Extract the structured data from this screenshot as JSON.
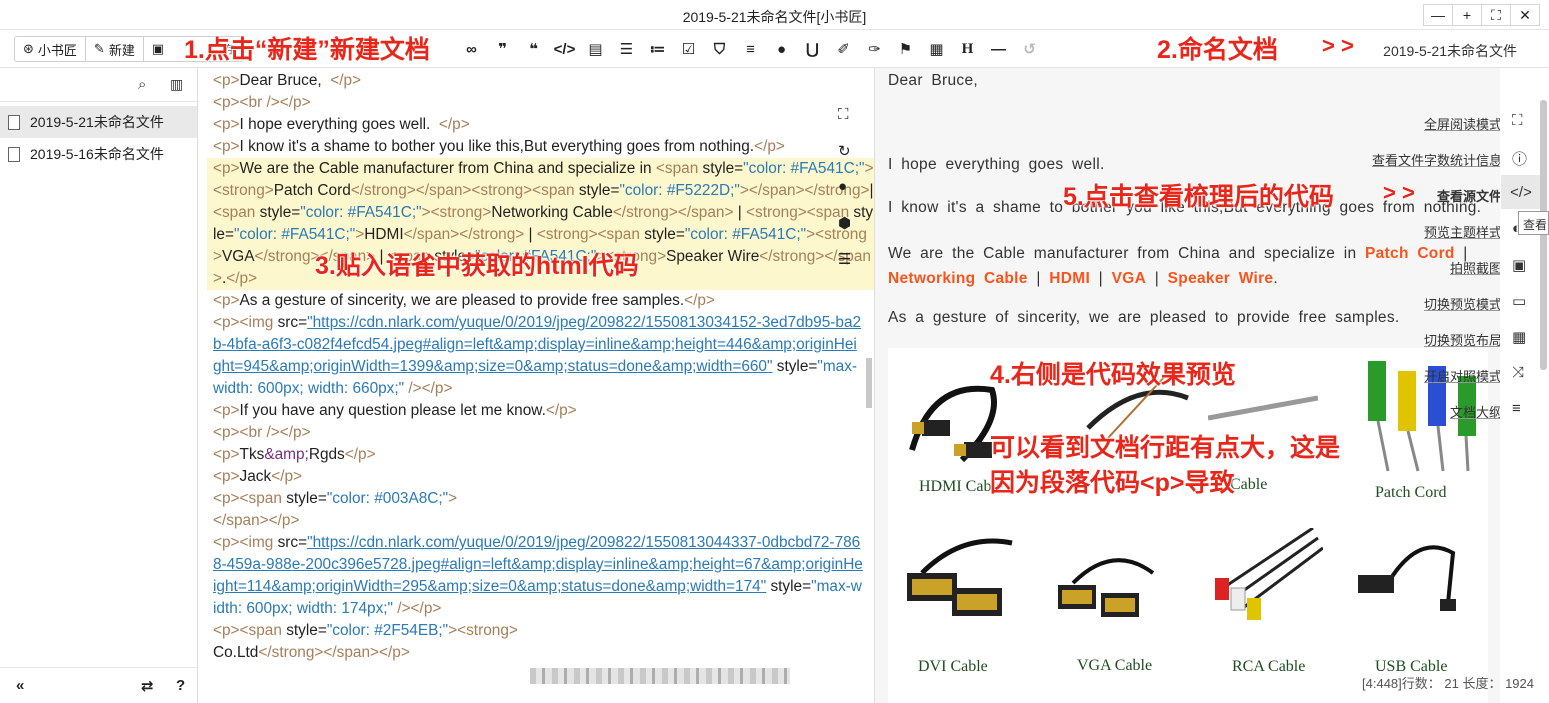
{
  "window": {
    "title": "2019-5-21未命名文件[小书匠]",
    "controls": [
      "—",
      "+",
      "⛶",
      "✕"
    ]
  },
  "toolbar": {
    "app_label": "小书匠",
    "new_label": "新建",
    "save_label": "存",
    "doc_name": "2019-5-21未命名文件",
    "icons": [
      "link-icon",
      "quote-open-icon",
      "quote-close-icon",
      "code-icon",
      "file-icon",
      "ordered-list-icon",
      "unordered-list-icon",
      "task-list-icon",
      "html5-icon",
      "align-icon",
      "clock-icon",
      "magnet-icon",
      "edit-note-icon",
      "edit-note-alt-icon",
      "flag-icon",
      "table-icon",
      "heading-icon",
      "hr-icon",
      "undo-icon"
    ]
  },
  "sidebar": {
    "files": [
      {
        "name": "2019-5-21未命名文件",
        "active": true
      },
      {
        "name": "2019-5-16未命名文件",
        "active": false
      }
    ],
    "bottom": {
      "collapse": "«",
      "swap": "⇄",
      "help": "?"
    }
  },
  "editor": {
    "lines": [
      {
        "parts": [
          [
            "t",
            "<p>"
          ],
          [
            "x",
            "Dear Bruce,  "
          ],
          [
            "t",
            "</p>"
          ]
        ]
      },
      {
        "parts": [
          [
            "t",
            "<p><br /></p>"
          ]
        ]
      },
      {
        "parts": [
          [
            "t",
            "<p>"
          ],
          [
            "x",
            "I hope everything goes well.  "
          ],
          [
            "t",
            "</p>"
          ]
        ]
      },
      {
        "parts": [
          [
            "t",
            "<p>"
          ],
          [
            "x",
            "I know it's a shame to bother you like this,But everything goes from nothing."
          ],
          [
            "t",
            "</p>"
          ]
        ]
      },
      {
        "hl": true,
        "parts": [
          [
            "t",
            "<p>"
          ],
          [
            "x",
            "We are the Cable manufacturer from China and specialize in "
          ],
          [
            "t",
            "<span "
          ],
          [
            "x",
            "style="
          ],
          [
            "s",
            "\"color: #FA541C;\""
          ],
          [
            "t",
            "><strong>"
          ],
          [
            "x",
            "Patch Cord"
          ],
          [
            "t",
            "</strong></span><strong><span "
          ],
          [
            "x",
            "style="
          ],
          [
            "s",
            "\"color: #F5222D;\""
          ],
          [
            "t",
            "></span></strong>"
          ],
          [
            "x",
            "| "
          ],
          [
            "t",
            "<span "
          ],
          [
            "x",
            "style="
          ],
          [
            "s",
            "\"color: #FA541C;\""
          ],
          [
            "t",
            "><strong>"
          ],
          [
            "x",
            "Networking Cable"
          ],
          [
            "t",
            "</strong></span>"
          ],
          [
            "x",
            " | "
          ],
          [
            "t",
            "<strong><span "
          ],
          [
            "x",
            "style="
          ],
          [
            "s",
            "\"color: #FA541C;\""
          ],
          [
            "t",
            ">"
          ],
          [
            "x",
            "HDMI"
          ],
          [
            "t",
            "</span></strong>"
          ],
          [
            "x",
            " | "
          ],
          [
            "t",
            "<strong><span "
          ],
          [
            "x",
            "style="
          ],
          [
            "s",
            "\"color: #FA541C;\""
          ],
          [
            "t",
            "><strong>"
          ],
          [
            "x",
            "VGA"
          ],
          [
            "t",
            "</strong></span>"
          ],
          [
            "x",
            " | "
          ],
          [
            "t",
            "<span "
          ],
          [
            "x",
            "style="
          ],
          [
            "s",
            "\"color: #FA541C;\""
          ],
          [
            "t",
            "><strong>"
          ],
          [
            "x",
            "Speaker Wire"
          ],
          [
            "t",
            "</strong></span>"
          ],
          [
            "x",
            "."
          ],
          [
            "t",
            "</p>"
          ]
        ]
      },
      {
        "parts": [
          [
            "t",
            "<p>"
          ],
          [
            "x",
            "As a gesture of sincerity, we are pleased to provide free samples."
          ],
          [
            "t",
            "</p>"
          ]
        ]
      },
      {
        "parts": [
          [
            "t",
            "<p><img "
          ],
          [
            "x",
            "src="
          ],
          [
            "l",
            "\"https://cdn.nlark.com/yuque/0/2019/jpeg/209822/1550813034152-3ed7db95-ba2b-4bfa-a6f3-c082f4efcd54.jpeg#align=left&amp;display=inline&amp;height=446&amp;originHeight=945&amp;originWidth=1399&amp;size=0&amp;status=done&amp;width=660\""
          ],
          [
            "x",
            " style="
          ],
          [
            "s",
            "\"max-width: 600px; width: 660px;\""
          ],
          [
            "t",
            " /></p>"
          ]
        ]
      },
      {
        "parts": [
          [
            "t",
            "<p>"
          ],
          [
            "x",
            "If you have any question please let me know."
          ],
          [
            "t",
            "</p>"
          ]
        ]
      },
      {
        "parts": [
          [
            "t",
            "<p><br /></p>"
          ]
        ]
      },
      {
        "parts": [
          [
            "t",
            "<p>"
          ],
          [
            "x",
            "Tks"
          ],
          [
            "e",
            "&amp;"
          ],
          [
            "x",
            "Rgds"
          ],
          [
            "t",
            "</p>"
          ]
        ]
      },
      {
        "parts": [
          [
            "t",
            "<p>"
          ],
          [
            "x",
            "Jack"
          ],
          [
            "t",
            "</p>"
          ]
        ]
      },
      {
        "parts": [
          [
            "t",
            "<p><span "
          ],
          [
            "x",
            "style="
          ],
          [
            "s",
            "\"color: #003A8C;\""
          ],
          [
            "t",
            ">"
          ]
        ]
      },
      {
        "parts": [
          [
            "t",
            "</span></p>"
          ]
        ]
      },
      {
        "parts": [
          [
            "t",
            "<p><img "
          ],
          [
            "x",
            "src="
          ],
          [
            "l",
            "\"https://cdn.nlark.com/yuque/0/2019/jpeg/209822/1550813044337-0dbcbd72-7868-459a-988e-200c396e5728.jpeg#align=left&amp;display=inline&amp;height=67&amp;originHeight=114&amp;originWidth=295&amp;size=0&amp;status=done&amp;width=174\""
          ],
          [
            "x",
            " style="
          ],
          [
            "s",
            "\"max-width: 600px; width: 174px;\""
          ],
          [
            "t",
            " /></p>"
          ]
        ]
      },
      {
        "parts": [
          [
            "t",
            "<p><span "
          ],
          [
            "x",
            "style="
          ],
          [
            "s",
            "\"color: #2F54EB;\""
          ],
          [
            "t",
            "><strong>"
          ]
        ]
      },
      {
        "parts": [
          [
            "x",
            "Co.Ltd"
          ],
          [
            "t",
            "</strong></span></p>"
          ]
        ]
      }
    ]
  },
  "preview": {
    "greeting": "Dear  Bruce,",
    "p1": "I  hope  everything  goes  well.",
    "p2": "I  know  it's  a  shame  to  bother  you  like  this,But  everything  goes  from  nothing.",
    "p3_pre": "We  are  the  Cable  manufacturer  from  China  and  specialize  in ",
    "p3_items": [
      "Patch Cord",
      "Networking Cable",
      "HDMI",
      "VGA",
      "Speaker Wire"
    ],
    "p4": "As  a  gesture  of  sincerity,  we  are  pleased  to  provide  free  samples.",
    "products": [
      "HDMI Cable",
      "Cable",
      "Patch Cord",
      "DVI Cable",
      "VGA Cable",
      "RCA Cable",
      "USB Cable"
    ]
  },
  "preview_menu": [
    {
      "label": "全屏阅读模式",
      "icon": "fullscreen-icon"
    },
    {
      "label": "查看文件字数统计信息",
      "icon": "info-icon"
    },
    {
      "label": "查看源文件",
      "icon": "code-icon"
    },
    {
      "label": "预览主题样式",
      "icon": "theme-icon"
    },
    {
      "label": "拍照截图",
      "icon": "camera-icon"
    },
    {
      "label": "切换预览模式",
      "icon": "monitor-icon"
    },
    {
      "label": "切换预览布局",
      "icon": "layout-icon"
    },
    {
      "label": "开启对照模式",
      "icon": "shuffle-icon"
    },
    {
      "label": "文档大纲",
      "icon": "outline-icon"
    }
  ],
  "tooltip_fragment": "查看",
  "status": "[4:448]行数： 21 长度： 1924",
  "annotations": {
    "a1": "1.点击“新建”新建文档",
    "a2": "2.命名文档",
    "a2_arrow": "> >",
    "a3": "3.贴入语雀中获取的html代码",
    "a4": "4.右侧是代码效果预览",
    "a4_note1": "可以看到文档行距有点大，这是",
    "a4_note2": "因为段落代码<p>导致",
    "a5": "5.点击查看梳理后的代码",
    "a5_arrow": "> >"
  },
  "colors": {
    "accent_orange": "#FA541C",
    "annotation_red": "#E8261A",
    "highlight": "#FDF7CD"
  }
}
